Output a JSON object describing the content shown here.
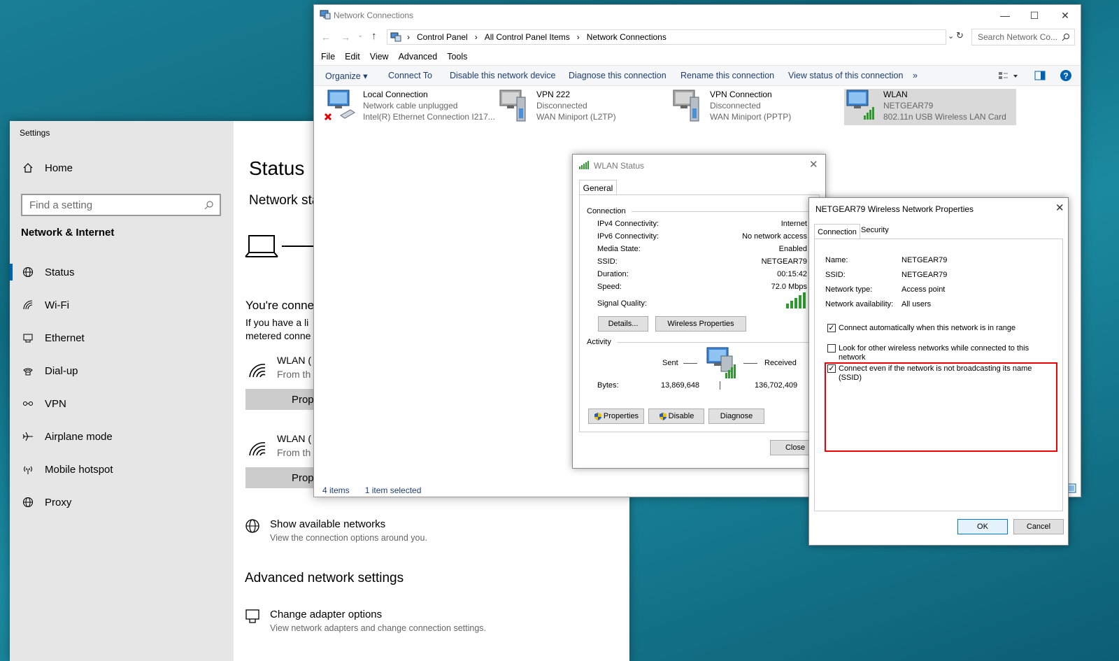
{
  "settings": {
    "title": "Settings",
    "home": "Home",
    "search_placeholder": "Find a setting",
    "group": "Network & Internet",
    "nav": [
      "Status",
      "Wi-Fi",
      "Ethernet",
      "Dial-up",
      "VPN",
      "Airplane mode",
      "Mobile hotspot",
      "Proxy"
    ],
    "main": {
      "heading": "Status",
      "subheading": "Network sta",
      "connected": "You're conne",
      "line1": "If you have a li",
      "line2": "metered conne",
      "wlan1_name": "WLAN (",
      "wlan1_sub": "From th",
      "wlan1_btn": "Prope",
      "wlan2_name": "WLAN (",
      "wlan2_sub": "From th",
      "wlan2_btn": "Prope",
      "show_networks": "Show available networks",
      "show_networks_desc": "View the connection options around you.",
      "advanced_heading": "Advanced network settings",
      "change_adapter": "Change adapter options",
      "change_adapter_desc": "View network adapters and change connection settings."
    }
  },
  "netconn": {
    "title": "Network Connections",
    "breadcrumb": [
      "Control Panel",
      "All Control Panel Items",
      "Network Connections"
    ],
    "search_placeholder": "Search Network Co...",
    "menu": [
      "File",
      "Edit",
      "View",
      "Advanced",
      "Tools"
    ],
    "commands": {
      "organize": "Organize ▾",
      "connect": "Connect To",
      "disable": "Disable this network device",
      "diagnose": "Diagnose this connection",
      "rename": "Rename this connection",
      "view_status": "View status of this connection",
      "more": "»"
    },
    "connections": [
      {
        "name": "Local Connection",
        "status": "Network cable unplugged",
        "device": "Intel(R) Ethernet Connection I217..."
      },
      {
        "name": "VPN 222",
        "status": "Disconnected",
        "device": "WAN Miniport (L2TP)"
      },
      {
        "name": "VPN Connection",
        "status": "Disconnected",
        "device": "WAN Miniport (PPTP)"
      },
      {
        "name": "WLAN",
        "status": "NETGEAR79",
        "device": "802.11n USB Wireless LAN Card"
      }
    ],
    "status_items": "4 items",
    "status_selected": "1 item selected"
  },
  "wlan_status": {
    "title": "WLAN Status",
    "tab": "General",
    "connection_label": "Connection",
    "rows": [
      {
        "k": "IPv4 Connectivity:",
        "v": "Internet"
      },
      {
        "k": "IPv6 Connectivity:",
        "v": "No network access"
      },
      {
        "k": "Media State:",
        "v": "Enabled"
      },
      {
        "k": "SSID:",
        "v": "NETGEAR79"
      },
      {
        "k": "Duration:",
        "v": "00:15:42"
      },
      {
        "k": "Speed:",
        "v": "72.0 Mbps"
      }
    ],
    "signal_label": "Signal Quality:",
    "details_btn": "Details...",
    "wireless_btn": "Wireless Properties",
    "activity_label": "Activity",
    "sent": "Sent",
    "received": "Received",
    "bytes_label": "Bytes:",
    "bytes_sent": "13,869,648",
    "bytes_received": "136,702,409",
    "properties_btn": "Properties",
    "disable_btn": "Disable",
    "diagnose_btn": "Diagnose",
    "close_btn": "Close"
  },
  "props": {
    "title": "NETGEAR79 Wireless Network Properties",
    "tab_connection": "Connection",
    "tab_security": "Security",
    "rows": [
      {
        "k": "Name:",
        "v": "NETGEAR79"
      },
      {
        "k": "SSID:",
        "v": "NETGEAR79"
      },
      {
        "k": "Network type:",
        "v": "Access point"
      },
      {
        "k": "Network availability:",
        "v": "All users"
      }
    ],
    "checks": [
      {
        "label": "Connect automatically when this network is in range",
        "checked": true
      },
      {
        "label": "Look for other wireless networks while connected to this network",
        "checked": false
      },
      {
        "label": "Connect even if the network is not broadcasting its name (SSID)",
        "checked": true
      }
    ],
    "ok": "OK",
    "cancel": "Cancel"
  },
  "colors": {
    "accent": "#0063b1",
    "highlight": "#e00000",
    "link": "#1e3f73"
  }
}
